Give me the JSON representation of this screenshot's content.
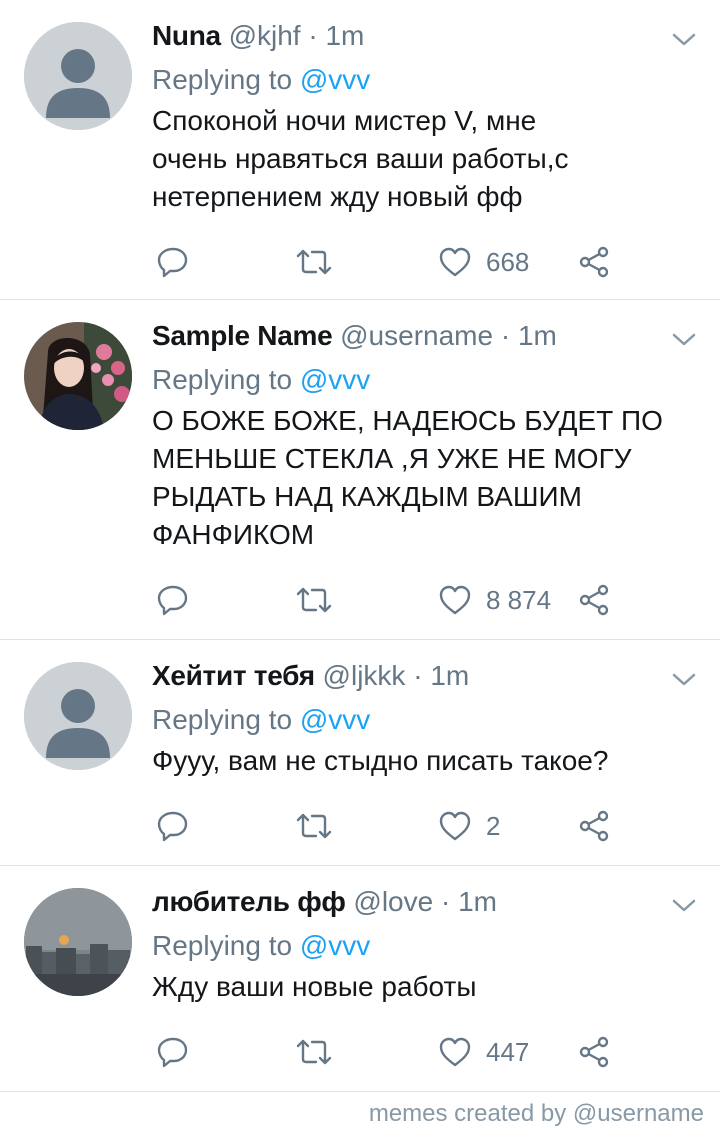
{
  "tweets": [
    {
      "display_name": "Nuna",
      "handle": "@kjhf",
      "sep": " · ",
      "time": "1m",
      "replying_prefix": "Replying to ",
      "replying_handle": "@vvv",
      "text": "Споконой ночи мистер V, мне\nочень нравяться ваши работы,с\nнетерпением жду новый фф",
      "likes": "668",
      "avatar": "default-avatar"
    },
    {
      "display_name": "Sample Name",
      "handle": "@username",
      "sep": " · ",
      "time": "1m",
      "replying_prefix": "Replying to ",
      "replying_handle": "@vvv",
      "text": "О БОЖЕ БОЖЕ, НАДЕЮСЬ БУДЕТ ПО\nМЕНЬШЕ СТЕКЛА ,Я УЖЕ НЕ МОГУ\nРЫДАТЬ НАД КАЖДЫМ ВАШИМ\nФАНФИКОМ",
      "likes": "8 874",
      "avatar": "photo-avatar-girl"
    },
    {
      "display_name": "Хейтит тебя",
      "handle": "@ljkkk",
      "sep": " · ",
      "time": "1m",
      "replying_prefix": "Replying to ",
      "replying_handle": "@vvv",
      "text": "Фууу, вам не стыдно писать такое?",
      "likes": "2",
      "avatar": "default-avatar"
    },
    {
      "display_name": "любитель фф",
      "handle": "@love",
      "sep": " · ",
      "time": "1m",
      "replying_prefix": "Replying to ",
      "replying_handle": "@vvv",
      "text": "Жду ваши новые работы",
      "likes": "447",
      "avatar": "photo-avatar-city"
    }
  ],
  "footer": "memes created by @username",
  "colors": {
    "link": "#1da1f2",
    "secondary": "#657786",
    "text": "#14171a",
    "divider": "#dfe3e6"
  }
}
